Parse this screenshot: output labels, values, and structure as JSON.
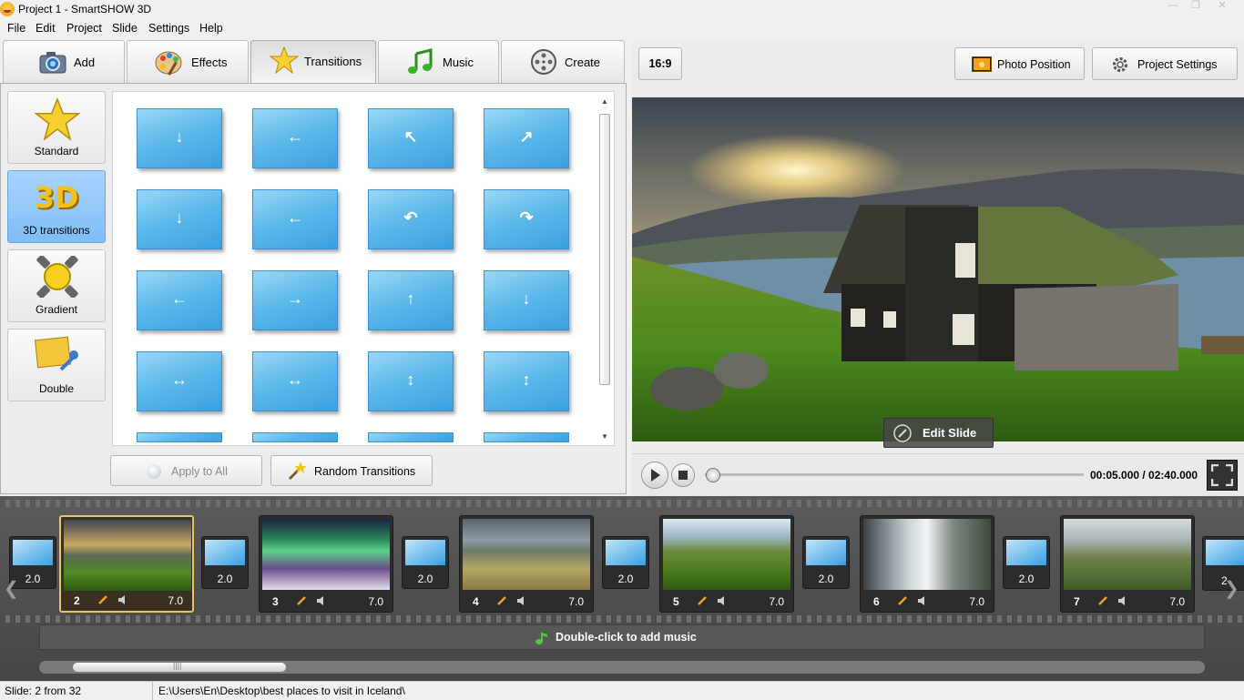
{
  "window": {
    "title": "Project 1 - SmartSHOW 3D"
  },
  "menu": [
    "File",
    "Edit",
    "Project",
    "Slide",
    "Settings",
    "Help"
  ],
  "tabs": [
    {
      "label": "Add",
      "icon": "camera-icon"
    },
    {
      "label": "Effects",
      "icon": "palette-icon"
    },
    {
      "label": "Transitions",
      "icon": "star-icon",
      "active": true
    },
    {
      "label": "Music",
      "icon": "music-note-icon"
    },
    {
      "label": "Create",
      "icon": "film-reel-icon"
    }
  ],
  "categories": [
    {
      "label": "Standard",
      "icon": "star-icon"
    },
    {
      "label": "3D transitions",
      "icon": "3d-icon",
      "badge": "3D",
      "active": true
    },
    {
      "label": "Gradient",
      "icon": "gradient-icon"
    },
    {
      "label": "Double",
      "icon": "double-icon"
    }
  ],
  "actions": {
    "apply_all": "Apply to All",
    "random": "Random Transitions"
  },
  "preview": {
    "ratio": "16:9",
    "photo_position": "Photo Position",
    "project_settings": "Project Settings",
    "edit_slide": "Edit Slide",
    "time": "00:05.000 / 02:40.000",
    "progress": 0.02
  },
  "timeline": {
    "lead_transition": "2.0",
    "slides": [
      {
        "number": "2",
        "duration": "7.0",
        "selected": true,
        "transition": "2.0"
      },
      {
        "number": "3",
        "duration": "7.0",
        "transition": "2.0"
      },
      {
        "number": "4",
        "duration": "7.0",
        "transition": "2.0"
      },
      {
        "number": "5",
        "duration": "7.0",
        "transition": "2.0"
      },
      {
        "number": "6",
        "duration": "7.0",
        "transition": "2.0"
      },
      {
        "number": "7",
        "duration": "7.0",
        "transition": "2"
      }
    ],
    "music_hint": "Double-click to add music"
  },
  "status": {
    "slide": "Slide: 2 from 32",
    "path": "E:\\Users\\En\\Desktop\\best places to visit in Iceland\\"
  },
  "colors": {
    "accent": "#7fbdf5",
    "selected_slide": "#e8c36a",
    "timeline_bg": "#4f4f4f"
  }
}
